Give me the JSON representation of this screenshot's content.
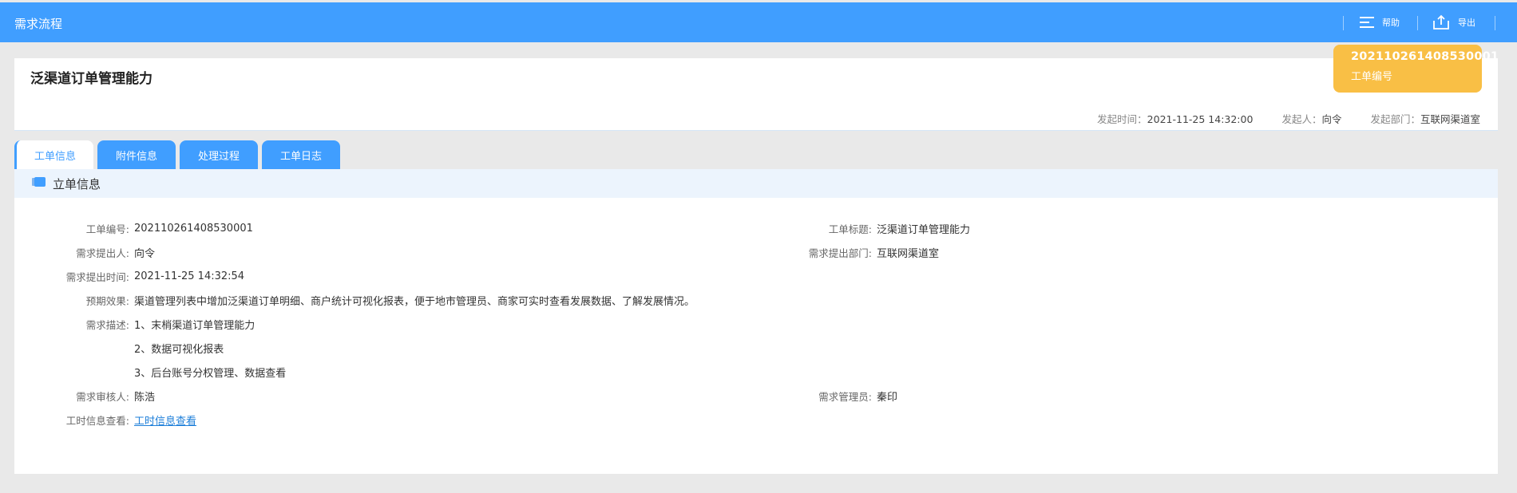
{
  "topbar": {
    "title": "需求流程",
    "help_label": "帮助",
    "export_label": "导出",
    "help_icon": "menu-lines-icon",
    "export_icon": "share-export-icon"
  },
  "header": {
    "title": "泛渠道订单管理能力",
    "badge": {
      "number": "202110261408530001",
      "label": "工单编号"
    },
    "meta": [
      {
        "key": "发起时间：",
        "value": "2021-11-25 14:32:00"
      },
      {
        "key": "发起人：",
        "value": "向令"
      },
      {
        "key": "发起部门：",
        "value": "互联网渠道室"
      }
    ]
  },
  "tabs": [
    {
      "label": "工单信息",
      "active": true
    },
    {
      "label": "附件信息",
      "active": false
    },
    {
      "label": "处理过程",
      "active": false
    },
    {
      "label": "工单日志",
      "active": false
    }
  ],
  "section": {
    "title": "立单信息",
    "icon": "folder-icon",
    "fields": {
      "order_no": {
        "label": "工单编号:",
        "value": "202110261408530001"
      },
      "order_title": {
        "label": "工单标题:",
        "value": "泛渠道订单管理能力"
      },
      "proposer": {
        "label": "需求提出人:",
        "value": "向令"
      },
      "dept": {
        "label": "需求提出部门:",
        "value": "互联网渠道室"
      },
      "time": {
        "label": "需求提出时间:",
        "value": "2021-11-25 14:32:54"
      },
      "effect": {
        "label": "预期效果:",
        "value": "渠道管理列表中增加泛渠道订单明细、商户统计可视化报表，便于地市管理员、商家可实时查看发展数据、了解发展情况。"
      },
      "desc": {
        "label": "需求描述:",
        "lines": [
          "1、末梢渠道订单管理能力",
          "2、数据可视化报表",
          "3、后台账号分权管理、数据查看"
        ]
      },
      "reviewer": {
        "label": "需求审核人:",
        "value": "陈浩"
      },
      "manager": {
        "label": "需求管理员:",
        "value": "秦印"
      },
      "hours": {
        "label": "工时信息查看:",
        "value": "工时信息查看"
      }
    }
  },
  "colors": {
    "primary": "#409eff",
    "badge": "#f9bf45",
    "section_bg": "#ecf4fd",
    "link": "#1e7fd9"
  }
}
